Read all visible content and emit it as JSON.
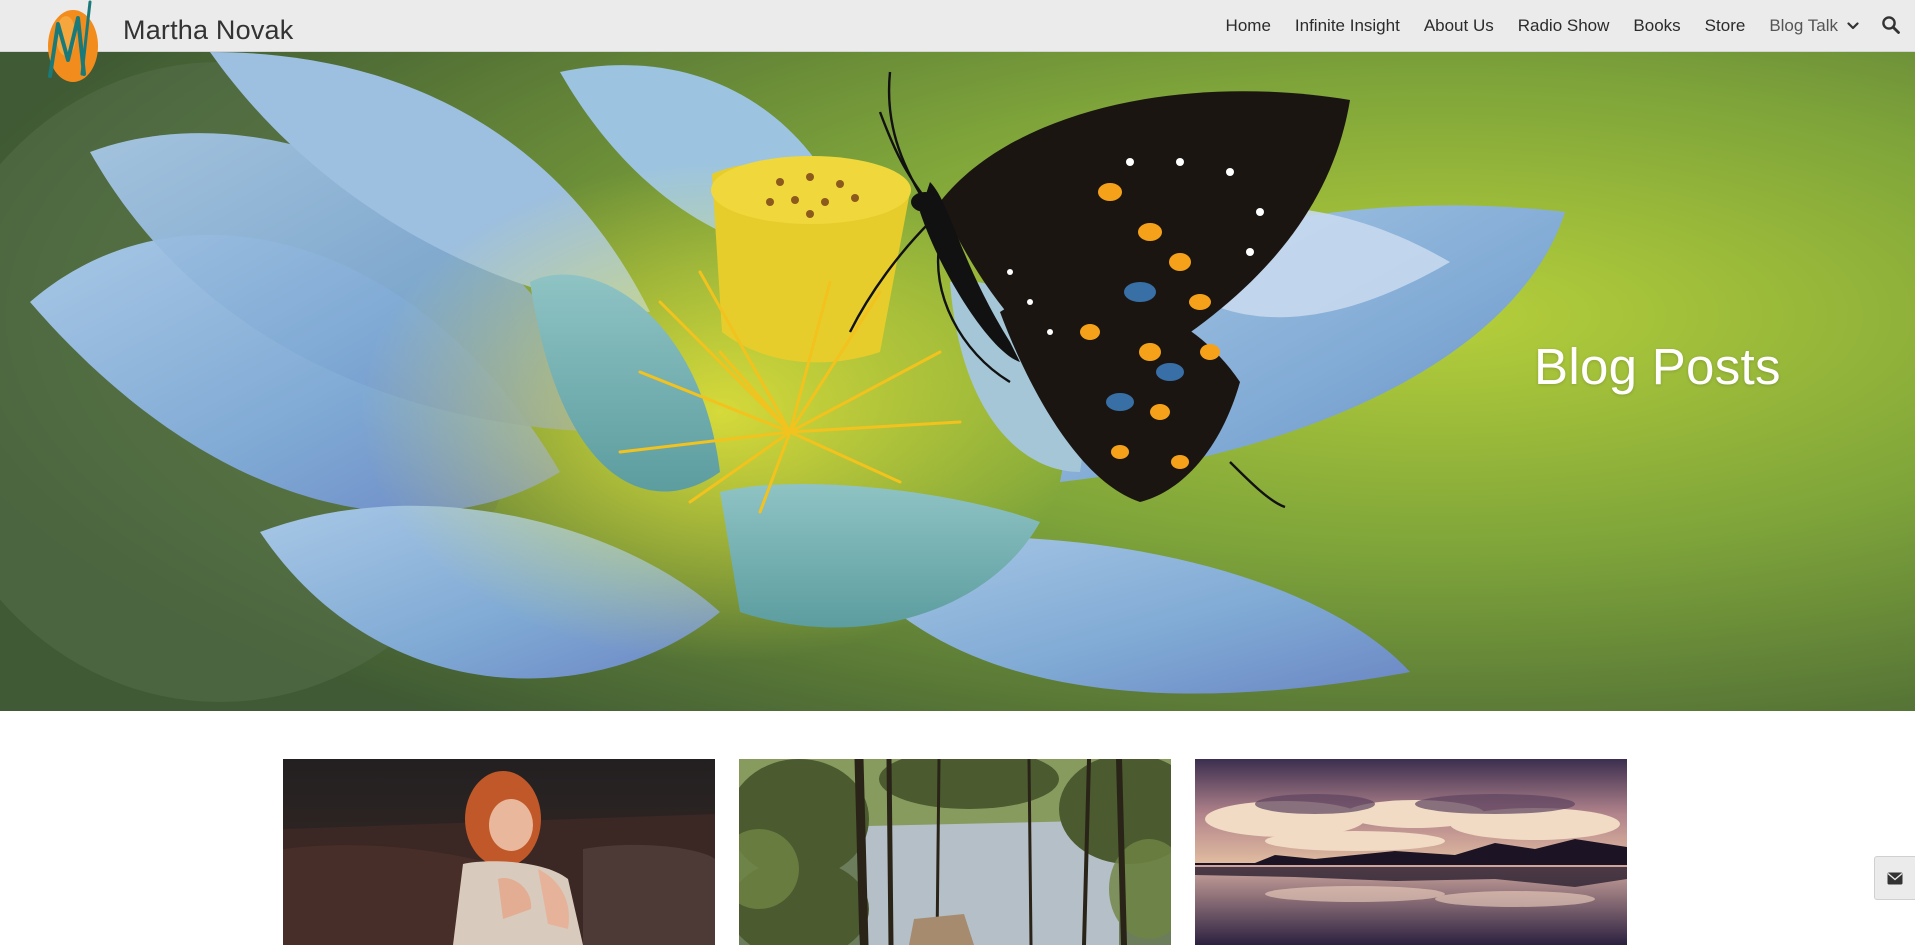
{
  "header": {
    "site_title": "Martha Novak",
    "logo_icon": "martha-novak-logo-m",
    "nav": [
      {
        "label": "Home"
      },
      {
        "label": "Infinite Insight"
      },
      {
        "label": "About Us"
      },
      {
        "label": "Radio Show"
      },
      {
        "label": "Books"
      },
      {
        "label": "Store"
      },
      {
        "label": "Blog Talk",
        "has_dropdown": true
      }
    ],
    "search_icon": "search-icon"
  },
  "hero": {
    "title": "Blog Posts",
    "image": "blue-lotus-flower-with-black-butterfly"
  },
  "posts": [
    {
      "image": "laughing-red-haired-woman-on-leather-couch"
    },
    {
      "image": "forest-trees-overlooking-lake-with-dock"
    },
    {
      "image": "purple-sunset-clouds-reflected-in-lake"
    }
  ],
  "floating": {
    "mail_icon": "envelope-icon"
  },
  "colors": {
    "header_bg": "#ebebeb",
    "hero_title": "#ffffff",
    "logo_orange": "#f28c1c",
    "logo_teal": "#1a7a7a"
  }
}
